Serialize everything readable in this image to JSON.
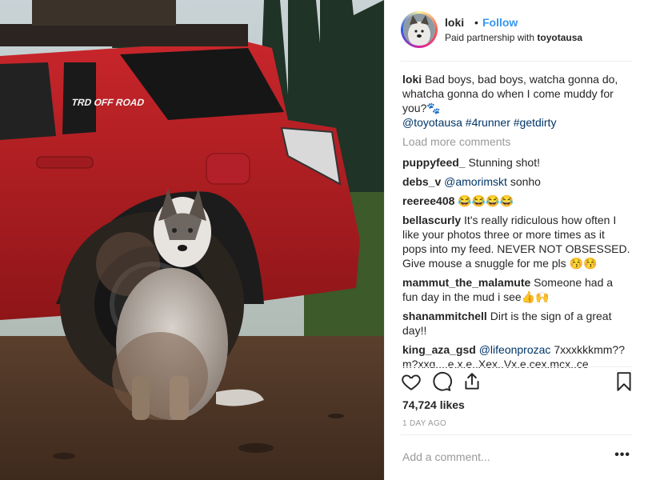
{
  "post": {
    "username": "loki",
    "follow_label": "Follow",
    "dot": "•",
    "partnership_prefix": "Paid partnership with",
    "partner": "toyotausa"
  },
  "caption": {
    "username": "loki",
    "text": "Bad boys, bad boys, watcha gonna do, whatcha gonna do when I come muddy for you?🐾",
    "tags": "@toyotausa #4runner #getdirty"
  },
  "load_more_label": "Load more comments",
  "comments": [
    {
      "user": "puppyfeed_",
      "text": "Stunning shot!"
    },
    {
      "user": "debs_v",
      "mention": "@amorimskt",
      "text": "sonho"
    },
    {
      "user": "reeree408",
      "text": "😂😂😂😂"
    },
    {
      "user": "bellascurly",
      "text": "It's really ridiculous how often I like your photos three or more times as it pops into my feed. NEVER NOT OBSESSED. Give mouse a snuggle for me pls 😚😚"
    },
    {
      "user": "mammut_the_malamute",
      "text": "Someone had a fun day in the mud i see👍🙌"
    },
    {
      "user": "shanammitchell",
      "text": "Dirt is the sign of a great day!!"
    },
    {
      "user": "king_aza_gsd",
      "mention": "@lifeonprozac",
      "text": "7xxxkkkmm?? m?xxq....e.x.e..Xex..Vx.e.cex.mcx..ce"
    }
  ],
  "likes": "74,724 likes",
  "time_ago": "1 DAY AGO",
  "comment_placeholder": "Add a comment...",
  "more_options": "•••",
  "icons": {
    "like": "heart-icon",
    "comment": "comment-icon",
    "share": "share-icon",
    "save": "bookmark-icon",
    "more": "more-options-icon"
  },
  "colors": {
    "follow": "#3897f0",
    "hashtag": "#003569",
    "muted": "#999999",
    "text": "#262626"
  }
}
